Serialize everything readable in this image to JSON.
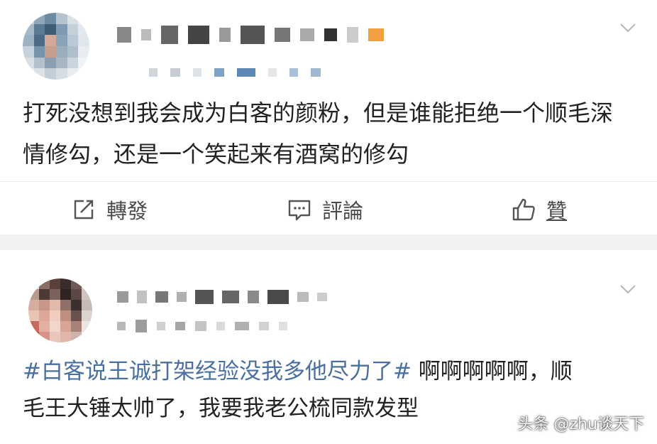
{
  "posts": [
    {
      "text": "打死没想到我会成为白客的颜粉，但是谁能拒绝一个顺毛深情修勾，还是一个笑起来有酒窝的修勾",
      "actions": {
        "repost_label": "轉發",
        "comment_label": "評論",
        "like_label": "贊"
      }
    },
    {
      "hashtag": "#白客说王诚打架经验没我多他尽力了#",
      "text": " 啊啊啊啊啊，顺毛王大锤太帅了，我要我老公梳同款发型"
    }
  ],
  "watermark": {
    "text": "头条 @zhu谈天下"
  },
  "colors": {
    "hashtag": "#4a6fa1",
    "separator": "#f2f2f2"
  },
  "icons": [
    "chevron-down-icon",
    "repost-icon",
    "comment-icon",
    "like-icon"
  ]
}
